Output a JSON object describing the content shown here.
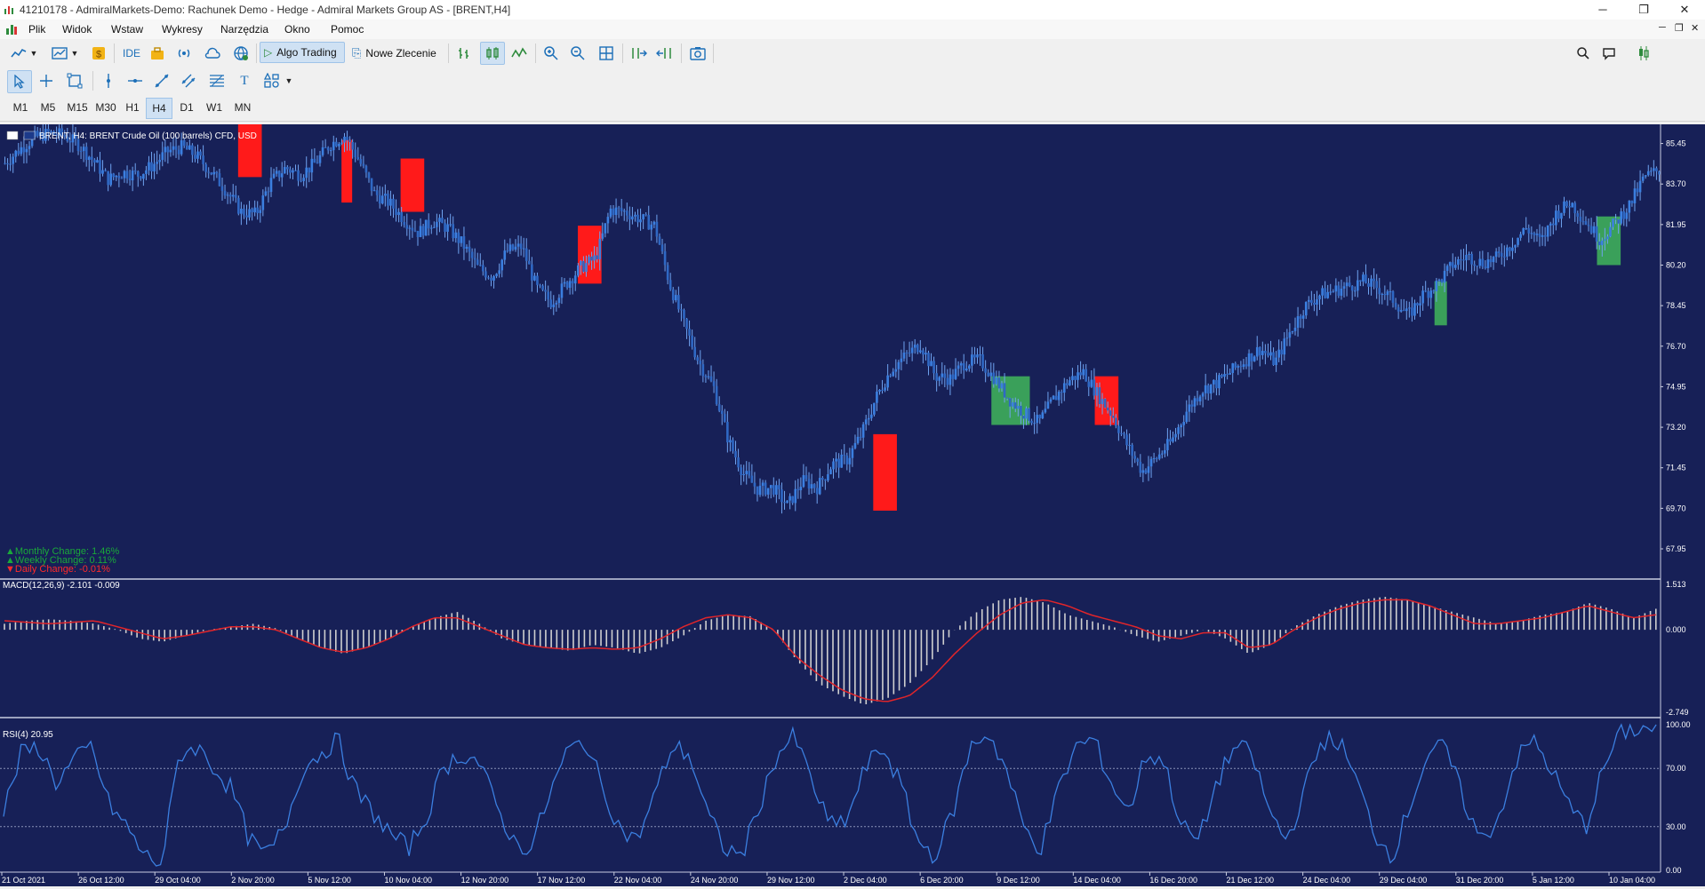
{
  "window": {
    "title": "41210178 - AdmiralMarkets-Demo: Rachunek Demo - Hedge - Admiral Markets Group AS - [BRENT,H4]",
    "controls": [
      "─",
      "❐",
      "✕"
    ]
  },
  "menu": {
    "items": [
      "Plik",
      "Widok",
      "Wstaw",
      "Wykresy",
      "Narzędzia",
      "Okno",
      "Pomoc"
    ],
    "mdi_controls": [
      "─",
      "❐",
      "✕"
    ]
  },
  "toolbar": {
    "ide_label": "IDE",
    "algo_label": "Algo Trading",
    "order_label": "Nowe Zlecenie",
    "notification_count": "1"
  },
  "timeframes": [
    "M1",
    "M5",
    "M15",
    "M30",
    "H1",
    "H4",
    "D1",
    "W1",
    "MN"
  ],
  "active_timeframe": "H4",
  "chart_header": "BRENT, H4:  BRENT Crude Oil (100 barrels) CFD, USD",
  "stats": {
    "monthly": "Monthly Change: 1.46%",
    "weekly": "Weekly Change: 0.11%",
    "daily": "Daily Change: -0.01%"
  },
  "colors": {
    "background": "#172057",
    "candle_up": "#3b7fe0",
    "candle_down": "#2f68c4",
    "red_box": "#ff1a1a",
    "green_box": "#3aa05a",
    "macd_hist": "#cfcfcf",
    "macd_signal": "#e0252a",
    "rsi_line": "#3b7fe0",
    "positive_stat": "#1aa83a",
    "negative_stat": "#ff2a2a"
  },
  "macd_label": "MACD(12,26,9) -2.101 -0.009",
  "rsi_label": "RSI(4) 20.95",
  "chart_data": [
    {
      "type": "candlestick",
      "symbol": "BRENT",
      "timeframe": "H4",
      "ylim": [
        66.8,
        86.2
      ],
      "y_ticks": [
        "85.45",
        "83.70",
        "81.95",
        "80.20",
        "78.45",
        "76.70",
        "74.95",
        "73.20",
        "71.45",
        "69.70",
        "67.95"
      ],
      "x_ticks": [
        "21 Oct 2021",
        "26 Oct 12:00",
        "29 Oct 04:00",
        "2 Nov 20:00",
        "5 Nov 12:00",
        "10 Nov 04:00",
        "12 Nov 20:00",
        "17 Nov 12:00",
        "22 Nov 04:00",
        "24 Nov 20:00",
        "29 Nov 12:00",
        "2 Dec 04:00",
        "6 Dec 20:00",
        "9 Dec 12:00",
        "14 Dec 04:00",
        "16 Dec 20:00",
        "21 Dec 12:00",
        "24 Dec 04:00",
        "29 Dec 04:00",
        "31 Dec 20:00",
        "5 Jan 12:00",
        "10 Jan 04:00"
      ],
      "price_path": [
        84.6,
        85.2,
        85.7,
        85.9,
        85.8,
        85.4,
        84.7,
        83.9,
        84.2,
        84.1,
        84.5,
        85.1,
        85.3,
        84.9,
        84.2,
        83.4,
        82.5,
        82.4,
        83.8,
        84.4,
        84.1,
        84.6,
        85.4,
        85.8,
        84.7,
        83.3,
        82.9,
        82.2,
        81.6,
        82.1,
        81.8,
        81.1,
        80.1,
        79.7,
        80.8,
        81.0,
        79.2,
        78.6,
        79.4,
        80.1,
        80.5,
        82.6,
        82.5,
        82.2,
        81.9,
        79.4,
        77.6,
        76.0,
        74.9,
        72.6,
        71.2,
        70.5,
        70.6,
        69.8,
        70.9,
        70.6,
        71.6,
        71.8,
        72.9,
        74.5,
        75.7,
        76.3,
        76.8,
        75.4,
        75.3,
        76.0,
        76.1,
        75.3,
        74.4,
        73.8,
        73.4,
        74.4,
        75.2,
        75.6,
        74.6,
        73.7,
        72.4,
        71.3,
        71.9,
        72.6,
        73.9,
        74.8,
        75.1,
        75.6,
        76.1,
        76.6,
        76.0,
        77.3,
        78.4,
        78.9,
        79.1,
        79.3,
        79.5,
        79.2,
        78.7,
        78.0,
        78.9,
        79.4,
        80.2,
        80.6,
        80.3,
        80.5,
        81.1,
        81.8,
        81.2,
        82.4,
        82.9,
        82.1,
        81.3,
        82.0,
        82.8,
        84.0,
        84.3
      ],
      "red_boxes": [
        {
          "start": 16,
          "end": 17,
          "low": 84.0,
          "high": 86.3
        },
        {
          "start": 23,
          "end": 23,
          "low": 82.9,
          "high": 85.6
        },
        {
          "start": 27,
          "end": 28,
          "low": 82.5,
          "high": 84.8
        },
        {
          "start": 39,
          "end": 40,
          "low": 79.4,
          "high": 81.9
        },
        {
          "start": 59,
          "end": 60,
          "low": 69.6,
          "high": 72.9
        },
        {
          "start": 74,
          "end": 75,
          "low": 73.3,
          "high": 75.4
        }
      ],
      "green_boxes": [
        {
          "start": 67,
          "end": 69,
          "low": 73.3,
          "high": 75.4
        },
        {
          "start": 97,
          "end": 97,
          "low": 77.6,
          "high": 79.5
        },
        {
          "start": 108,
          "end": 109,
          "low": 80.2,
          "high": 82.3
        }
      ]
    },
    {
      "type": "bar",
      "name": "MACD(12,26,9)",
      "ylim": [
        -2.749,
        1.513
      ],
      "y_ticks": [
        "1.513",
        "0.000",
        "-2.749"
      ],
      "histogram_path": [
        0.2,
        0.3,
        0.35,
        0.3,
        0.2,
        0.0,
        -0.3,
        -0.4,
        -0.2,
        0.0,
        0.1,
        0.2,
        0.05,
        -0.3,
        -0.6,
        -0.8,
        -0.6,
        -0.3,
        0.1,
        0.4,
        0.6,
        0.2,
        -0.3,
        -0.5,
        -0.6,
        -0.7,
        -0.5,
        -0.6,
        -0.8,
        -0.6,
        -0.2,
        0.3,
        0.5,
        0.45,
        0.0,
        -1.0,
        -1.8,
        -2.2,
        -2.5,
        -2.3,
        -1.8,
        -1.0,
        0.0,
        0.6,
        1.0,
        1.1,
        0.9,
        0.5,
        0.3,
        0.1,
        -0.2,
        -0.4,
        -0.2,
        0.0,
        -0.3,
        -0.8,
        -0.5,
        0.1,
        0.5,
        0.8,
        1.0,
        1.1,
        1.0,
        0.8,
        0.6,
        0.4,
        0.2,
        0.3,
        0.5,
        0.6,
        0.9,
        0.7,
        0.4,
        0.7
      ],
      "signal_path": [
        0.3,
        0.25,
        0.2,
        0.25,
        0.3,
        0.1,
        -0.1,
        -0.3,
        -0.2,
        -0.05,
        0.1,
        0.1,
        0.0,
        -0.3,
        -0.6,
        -0.75,
        -0.6,
        -0.3,
        0.1,
        0.4,
        0.4,
        0.1,
        -0.2,
        -0.5,
        -0.6,
        -0.65,
        -0.6,
        -0.65,
        -0.6,
        -0.3,
        0.1,
        0.4,
        0.5,
        0.4,
        0.0,
        -0.9,
        -1.5,
        -2.0,
        -2.3,
        -2.4,
        -2.2,
        -1.6,
        -0.8,
        -0.1,
        0.5,
        0.9,
        1.0,
        0.8,
        0.5,
        0.3,
        0.1,
        -0.2,
        -0.3,
        -0.1,
        -0.1,
        -0.6,
        -0.5,
        0.0,
        0.4,
        0.7,
        0.9,
        1.0,
        1.0,
        0.8,
        0.5,
        0.2,
        0.2,
        0.3,
        0.4,
        0.6,
        0.8,
        0.6,
        0.4,
        0.5
      ]
    },
    {
      "type": "line",
      "name": "RSI(4)",
      "ylim": [
        0,
        100
      ],
      "y_ticks": [
        "100.00",
        "70.00",
        "30.00",
        "0.00"
      ],
      "levels": [
        70,
        30
      ],
      "values": [
        40,
        80,
        85,
        60,
        75,
        85,
        45,
        30,
        10,
        5,
        80,
        85,
        70,
        55,
        20,
        10,
        30,
        70,
        80,
        90,
        55,
        40,
        25,
        15,
        35,
        70,
        80,
        75,
        45,
        20,
        15,
        50,
        80,
        90,
        60,
        30,
        20,
        50,
        85,
        80,
        40,
        15,
        10,
        45,
        80,
        92,
        60,
        30,
        35,
        70,
        85,
        60,
        20,
        10,
        40,
        85,
        95,
        70,
        30,
        15,
        55,
        85,
        90,
        60,
        40,
        80,
        75,
        30,
        20,
        60,
        85,
        80,
        40,
        20,
        55,
        90,
        88,
        60,
        25,
        10,
        45,
        80,
        85,
        50,
        20,
        35,
        75,
        90,
        70,
        45,
        30,
        70,
        95,
        97,
        98
      ]
    }
  ]
}
